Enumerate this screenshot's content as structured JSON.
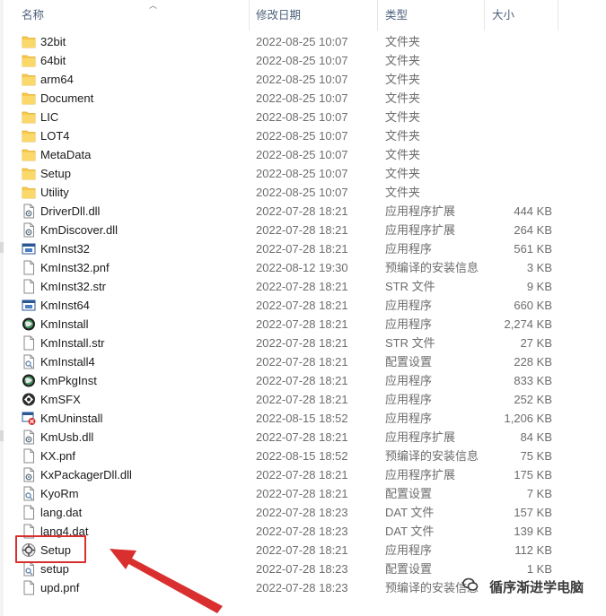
{
  "columns": {
    "name": "名称",
    "date": "修改日期",
    "type": "类型",
    "size": "大小"
  },
  "files": [
    {
      "name": "32bit",
      "date": "2022-08-25 10:07",
      "type": "文件夹",
      "size": "",
      "icon": "folder-icon"
    },
    {
      "name": "64bit",
      "date": "2022-08-25 10:07",
      "type": "文件夹",
      "size": "",
      "icon": "folder-icon"
    },
    {
      "name": "arm64",
      "date": "2022-08-25 10:07",
      "type": "文件夹",
      "size": "",
      "icon": "folder-icon"
    },
    {
      "name": "Document",
      "date": "2022-08-25 10:07",
      "type": "文件夹",
      "size": "",
      "icon": "folder-icon"
    },
    {
      "name": "LIC",
      "date": "2022-08-25 10:07",
      "type": "文件夹",
      "size": "",
      "icon": "folder-icon"
    },
    {
      "name": "LOT4",
      "date": "2022-08-25 10:07",
      "type": "文件夹",
      "size": "",
      "icon": "folder-icon"
    },
    {
      "name": "MetaData",
      "date": "2022-08-25 10:07",
      "type": "文件夹",
      "size": "",
      "icon": "folder-icon"
    },
    {
      "name": "Setup",
      "date": "2022-08-25 10:07",
      "type": "文件夹",
      "size": "",
      "icon": "folder-icon"
    },
    {
      "name": "Utility",
      "date": "2022-08-25 10:07",
      "type": "文件夹",
      "size": "",
      "icon": "folder-icon"
    },
    {
      "name": "DriverDll.dll",
      "date": "2022-07-28 18:21",
      "type": "应用程序扩展",
      "size": "444 KB",
      "icon": "dll-file-icon"
    },
    {
      "name": "KmDiscover.dll",
      "date": "2022-07-28 18:21",
      "type": "应用程序扩展",
      "size": "264 KB",
      "icon": "dll-file-icon"
    },
    {
      "name": "KmInst32",
      "date": "2022-07-28 18:21",
      "type": "应用程序",
      "size": "561 KB",
      "icon": "exe-window-icon"
    },
    {
      "name": "KmInst32.pnf",
      "date": "2022-08-12 19:30",
      "type": "预编译的安装信息",
      "size": "3 KB",
      "icon": "blank-file-icon"
    },
    {
      "name": "KmInst32.str",
      "date": "2022-07-28 18:21",
      "type": "STR 文件",
      "size": "9 KB",
      "icon": "blank-file-icon"
    },
    {
      "name": "KmInst64",
      "date": "2022-07-28 18:21",
      "type": "应用程序",
      "size": "660 KB",
      "icon": "exe-window-icon"
    },
    {
      "name": "KmInstall",
      "date": "2022-07-28 18:21",
      "type": "应用程序",
      "size": "2,274 KB",
      "icon": "globe-app-icon"
    },
    {
      "name": "KmInstall.str",
      "date": "2022-07-28 18:21",
      "type": "STR 文件",
      "size": "27 KB",
      "icon": "blank-file-icon"
    },
    {
      "name": "KmInstall4",
      "date": "2022-07-28 18:21",
      "type": "配置设置",
      "size": "228 KB",
      "icon": "settings-file-icon"
    },
    {
      "name": "KmPkgInst",
      "date": "2022-07-28 18:21",
      "type": "应用程序",
      "size": "833 KB",
      "icon": "globe-app-icon"
    },
    {
      "name": "KmSFX",
      "date": "2022-07-28 18:21",
      "type": "应用程序",
      "size": "252 KB",
      "icon": "sfx-app-icon"
    },
    {
      "name": "KmUninstall",
      "date": "2022-08-15 18:52",
      "type": "应用程序",
      "size": "1,206 KB",
      "icon": "uninstall-app-icon"
    },
    {
      "name": "KmUsb.dll",
      "date": "2022-07-28 18:21",
      "type": "应用程序扩展",
      "size": "84 KB",
      "icon": "dll-file-icon"
    },
    {
      "name": "KX.pnf",
      "date": "2022-08-15 18:52",
      "type": "预编译的安装信息",
      "size": "75 KB",
      "icon": "blank-file-icon"
    },
    {
      "name": "KxPackagerDll.dll",
      "date": "2022-07-28 18:21",
      "type": "应用程序扩展",
      "size": "175 KB",
      "icon": "dll-file-icon"
    },
    {
      "name": "KyoRm",
      "date": "2022-07-28 18:21",
      "type": "配置设置",
      "size": "7 KB",
      "icon": "settings-file-icon"
    },
    {
      "name": "lang.dat",
      "date": "2022-07-28 18:23",
      "type": "DAT 文件",
      "size": "157 KB",
      "icon": "blank-file-icon"
    },
    {
      "name": "lang4.dat",
      "date": "2022-07-28 18:23",
      "type": "DAT 文件",
      "size": "139 KB",
      "icon": "blank-file-icon"
    },
    {
      "name": "Setup",
      "date": "2022-07-28 18:21",
      "type": "应用程序",
      "size": "112 KB",
      "icon": "setup-app-icon"
    },
    {
      "name": "setup",
      "date": "2022-07-28 18:23",
      "type": "配置设置",
      "size": "1 KB",
      "icon": "settings-file-icon"
    },
    {
      "name": "upd.pnf",
      "date": "2022-07-28 18:23",
      "type": "预编译的安装信息",
      "size": "",
      "icon": "blank-file-icon"
    }
  ],
  "watermark": {
    "text": "循序渐进学电脑",
    "icon": "wechat-icon"
  },
  "annotation": {
    "color": "#d9302f",
    "target": "Setup"
  },
  "colors": {
    "folder": "#f8c94d",
    "header_text": "#4c607a",
    "secondary_text": "#6d6d6d"
  }
}
